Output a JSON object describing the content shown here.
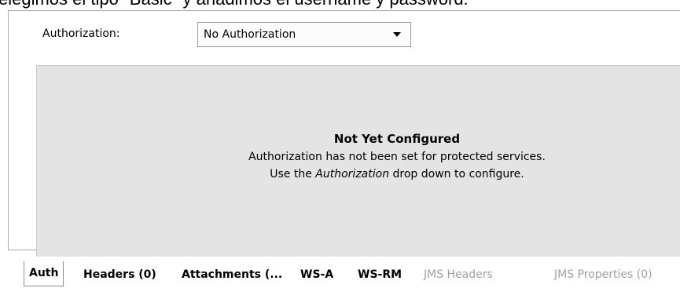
{
  "caption": "elegimos el tipo \"Basic\" y añadimos el username y password.",
  "authorization": {
    "label": "Authorization:",
    "selected": "No Authorization"
  },
  "status": {
    "title": "Not Yet Configured",
    "line1": "Authorization has not been set for protected services.",
    "line2_prefix": "Use the ",
    "line2_emphasis": "Authorization",
    "line2_suffix": " drop down to configure."
  },
  "tabs": [
    {
      "label": "Auth",
      "state": "active"
    },
    {
      "label": "Headers (0)",
      "state": "enabled"
    },
    {
      "label": "Attachments (...",
      "state": "enabled"
    },
    {
      "label": "WS-A",
      "state": "enabled"
    },
    {
      "label": "WS-RM",
      "state": "enabled"
    },
    {
      "label": "JMS Headers",
      "state": "disabled"
    },
    {
      "label": "JMS Properties (0)",
      "state": "disabled"
    }
  ]
}
